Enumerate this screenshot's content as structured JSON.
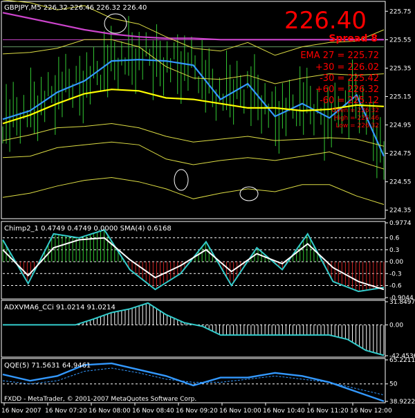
{
  "chart_data": [
    {
      "type": "line",
      "panel": "price",
      "title": "GBPJPY,M5  226.32 226.46 226.32 226.40",
      "big_price": "226.40",
      "spread_label": "Spread 8",
      "ylim": [
        224.3,
        225.8
      ],
      "y_ticks": [
        "225.75",
        "225.55",
        "225.35",
        "225.15",
        "224.95",
        "224.75",
        "224.55",
        "224.35"
      ],
      "x_ticks": [
        "16 Nov 2007",
        "16 Nov 07:20",
        "16 Nov 08:00",
        "16 Nov 08:40",
        "16 Nov 09:20",
        "16 Nov 10:00",
        "16 Nov 10:40",
        "16 Nov 11:20",
        "16 Nov 12:00"
      ],
      "overlay_text": {
        "ema": "EMA 27 = 225.72",
        "lines": [
          "+30 = 226.02",
          "-30 = 225.42",
          "+60 = 226.32",
          "-60 = 225.12"
        ],
        "ohl": [
          "Open = 226.32",
          "High = 226.46",
          "Low = 226.32"
        ]
      },
      "series": [
        {
          "color": "#cc44cc",
          "values": [
            225.74,
            225.7,
            225.66,
            225.62,
            225.59,
            225.57,
            225.56,
            225.56,
            225.55,
            225.55,
            225.55,
            225.55,
            225.55,
            225.55,
            225.55
          ]
        },
        {
          "color": "#3399ff",
          "values": [
            224.99,
            225.05,
            225.18,
            225.26,
            225.4,
            225.41,
            225.4,
            225.37,
            225.13,
            225.24,
            225.01,
            225.1,
            225.0,
            225.16,
            224.73
          ]
        },
        {
          "color": "#ffff00",
          "values": [
            224.96,
            225.02,
            225.1,
            225.17,
            225.2,
            225.19,
            225.14,
            225.13,
            225.1,
            225.07,
            225.07,
            225.05,
            225.06,
            225.09,
            225.08
          ]
        },
        {
          "color": "#dddd44",
          "values": [
            225.83,
            225.81,
            225.76,
            225.79,
            225.7,
            225.66,
            225.57,
            225.49,
            225.47,
            225.53,
            225.44,
            225.5,
            225.53,
            225.54,
            225.62
          ]
        },
        {
          "color": "#dddd44",
          "values": [
            225.45,
            225.46,
            225.49,
            225.55,
            225.55,
            225.5,
            225.36,
            225.28,
            225.27,
            225.3,
            225.24,
            225.28,
            225.31,
            225.3,
            225.31
          ]
        },
        {
          "color": "#dddd44",
          "values": [
            224.84,
            224.88,
            224.93,
            224.94,
            224.96,
            224.93,
            224.87,
            224.83,
            224.85,
            224.87,
            224.84,
            224.85,
            224.86,
            224.85,
            224.8
          ]
        },
        {
          "color": "#dddd44",
          "values": [
            224.72,
            224.73,
            224.79,
            224.81,
            224.83,
            224.81,
            224.71,
            224.67,
            224.7,
            224.72,
            224.7,
            224.73,
            224.76,
            224.7,
            224.64
          ]
        },
        {
          "color": "#dddd44",
          "values": [
            224.44,
            224.47,
            224.52,
            224.56,
            224.58,
            224.55,
            224.5,
            224.43,
            224.47,
            224.5,
            224.48,
            224.53,
            224.53,
            224.45,
            224.39
          ]
        }
      ],
      "horizontal_levels": [
        225.55,
        225.5
      ]
    },
    {
      "type": "line",
      "panel": "chimp",
      "title": "Chimp2_1 0.4749 0.4749 0.0000  SMA(4) 0.6168",
      "ylim": [
        -0.9044,
        0.9774
      ],
      "y_ticks": [
        "0.9774",
        "0.6",
        "0.3",
        "0.00",
        "-0.3",
        "-0.6",
        "-0.9044"
      ],
      "series": [
        {
          "name": "Chimp2_1",
          "color": "#33cccc",
          "values": [
            0.55,
            -0.55,
            0.7,
            0.6,
            0.8,
            -0.2,
            -0.7,
            -0.3,
            0.5,
            -0.6,
            0.35,
            -0.2,
            0.7,
            -0.5,
            -0.75,
            -0.65
          ]
        },
        {
          "name": "SMA(4)",
          "color": "#ffffff",
          "values": [
            0.3,
            -0.35,
            0.35,
            0.55,
            0.6,
            0.05,
            -0.4,
            -0.1,
            0.3,
            -0.25,
            0.2,
            -0.05,
            0.45,
            -0.15,
            -0.5,
            -0.7
          ]
        }
      ]
    },
    {
      "type": "line",
      "panel": "adx",
      "title": "ADXVMA6_CCi 91.0214 91.0214",
      "ylim": [
        -42.4536,
        31.8497
      ],
      "y_ticks": [
        "31.8497",
        "0.00",
        "-42.4536"
      ],
      "values": [
        0.0,
        0.0,
        0.0,
        0.0,
        0.0,
        8.0,
        17.0,
        22.0,
        30.0,
        14.0,
        3.0,
        -2.0,
        -14.0,
        -14.0,
        -14.0,
        -14.0,
        -14.0,
        -14.0,
        -14.0,
        -20.0,
        -35.0,
        -42.0
      ]
    },
    {
      "type": "line",
      "panel": "qqe",
      "title": "QQE(5) 71.5631 64.9461",
      "ylim": [
        38.9222,
        65.2211
      ],
      "y_ticks": [
        "65.2211",
        "50",
        "38.9222"
      ],
      "series": [
        {
          "color": "#3399ff",
          "values": [
            56.0,
            52.0,
            55.0,
            62.0,
            63.0,
            59.0,
            55.0,
            49.0,
            54.0,
            54.0,
            57.0,
            55.0,
            51.0,
            45.0,
            39.0
          ]
        },
        {
          "color": "#3399ff",
          "values": [
            52.0,
            50.0,
            52.0,
            58.0,
            60.0,
            57.0,
            53.0,
            51.0,
            51.0,
            53.0,
            55.0,
            53.0,
            51.0,
            47.0,
            43.0
          ]
        }
      ],
      "footer": "FXDD - MetaTrader, © 2001-2007 MetaQuotes Software Corp."
    }
  ]
}
